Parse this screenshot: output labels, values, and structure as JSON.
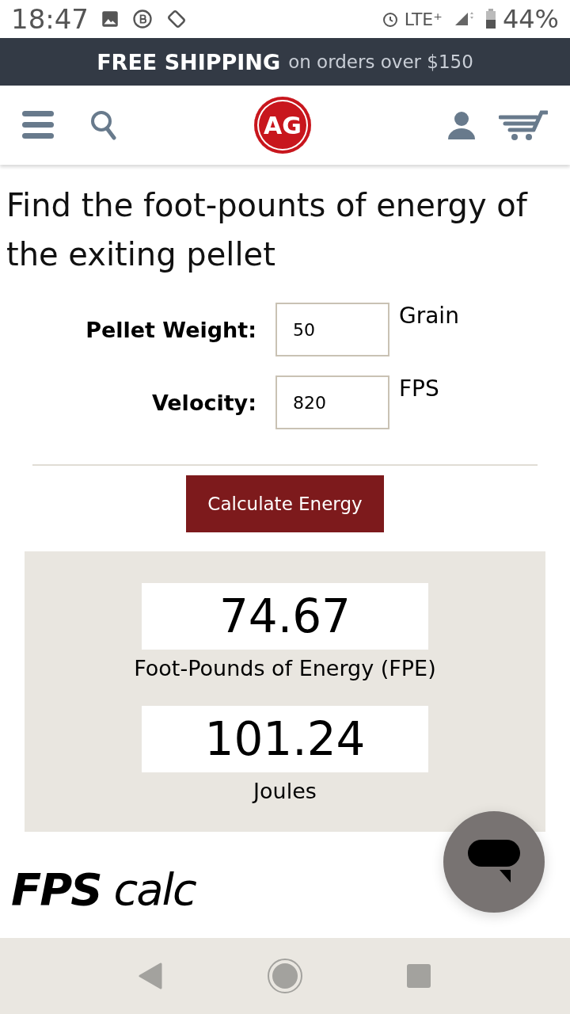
{
  "status_bar": {
    "time": "18:47",
    "network": "LTE⁺",
    "battery": "44%"
  },
  "banner": {
    "bold": "FREE SHIPPING",
    "text": "on orders over $150"
  },
  "header": {
    "logo": "AG"
  },
  "title": "Find the foot-pounts of energy of the exiting pellet",
  "fields": [
    {
      "label": "Pellet Weight:",
      "value": "50",
      "unit": "Grain"
    },
    {
      "label": "Velocity:",
      "value": "820",
      "unit": "FPS"
    }
  ],
  "button": "Calculate Energy",
  "results": [
    {
      "value": "74.67",
      "label": "Foot-Pounds of Energy (FPE)"
    },
    {
      "value": "101.24",
      "label": "Joules"
    }
  ],
  "footer_heading": "**FPS** calc"
}
